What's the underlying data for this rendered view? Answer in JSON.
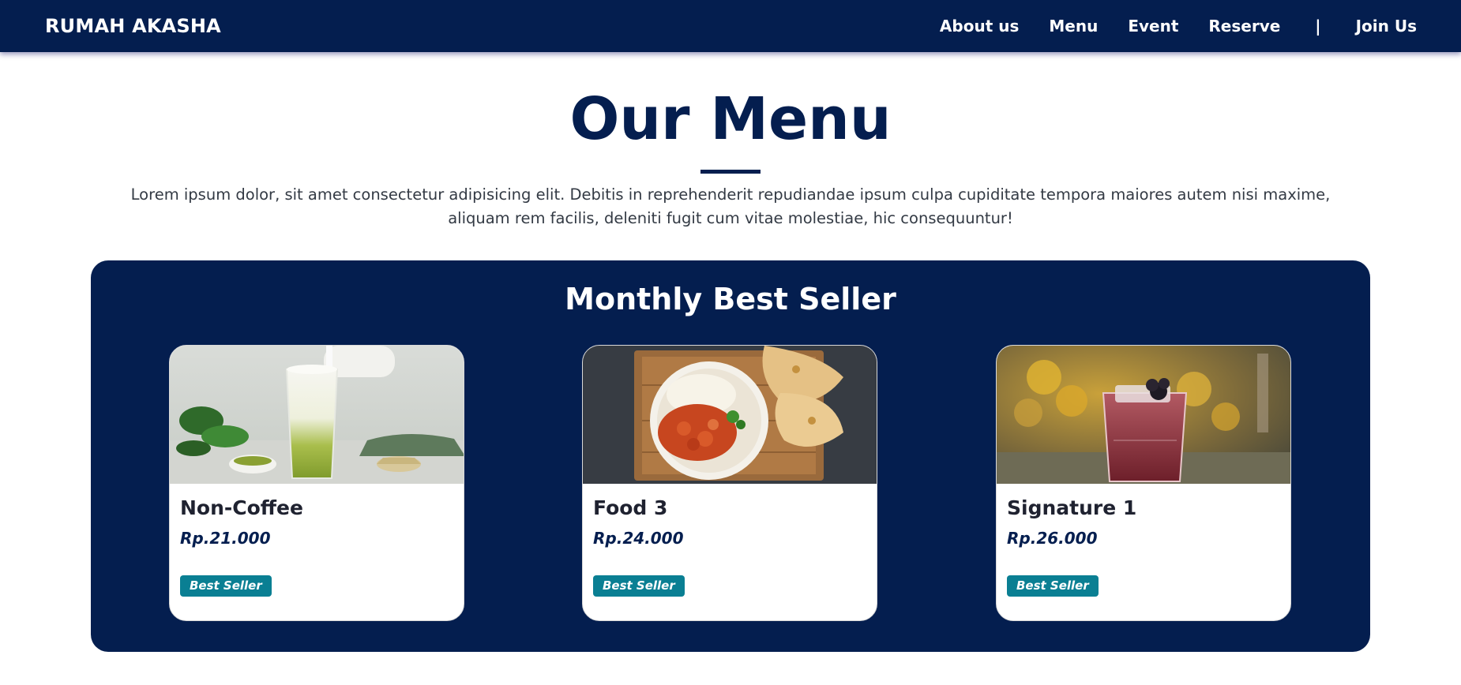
{
  "nav": {
    "brand": "RUMAH AKASHA",
    "links": [
      "About us",
      "Menu",
      "Event",
      "Reserve",
      "Join Us"
    ],
    "separator": "|"
  },
  "hero": {
    "title": "Our Menu",
    "description": "Lorem ipsum dolor, sit amet consectetur adipisicing elit. Debitis in reprehenderit repudiandae ipsum culpa cupiditate tempora maiores autem nisi maxime, aliquam rem facilis, deleniti fugit cum vitae molestiae, hic consequuntur!"
  },
  "best_seller": {
    "title": "Monthly Best Seller",
    "items": [
      {
        "name": "Non-Coffee",
        "price": "Rp.21.000",
        "badge": "Best Seller",
        "image": "matcha-latte-photo"
      },
      {
        "name": "Food 3",
        "price": "Rp.24.000",
        "badge": "Best Seller",
        "image": "curry-rice-naan-photo"
      },
      {
        "name": "Signature 1",
        "price": "Rp.26.000",
        "badge": "Best Seller",
        "image": "berry-cocktail-photo"
      }
    ]
  },
  "colors": {
    "navy": "#041e4f",
    "badge_teal": "#0a7f93"
  }
}
